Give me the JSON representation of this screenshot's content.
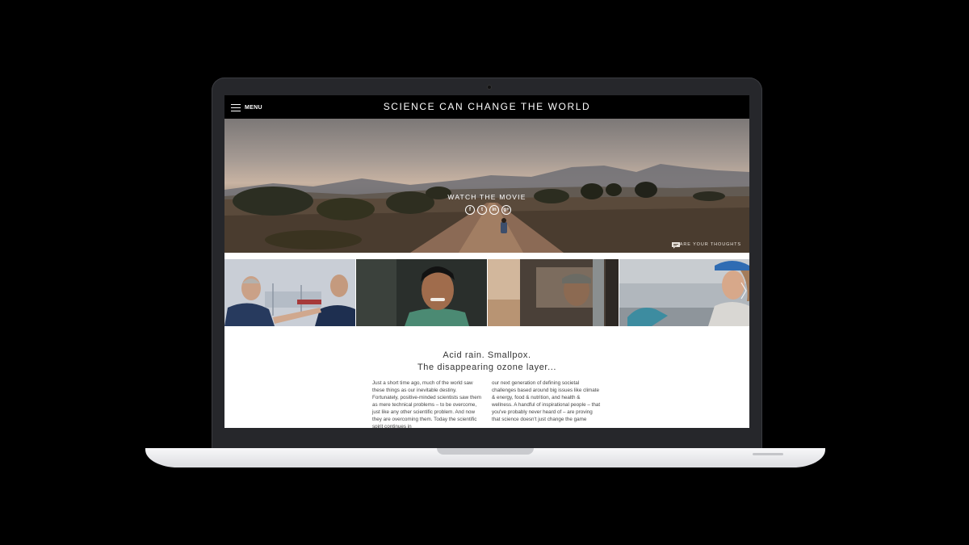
{
  "site": {
    "menu_label": "MENU",
    "title": "SCIENCE CAN CHANGE THE WORLD"
  },
  "hero": {
    "watch_label": "WATCH THE MOVIE",
    "social": [
      {
        "icon": "facebook-icon",
        "glyph": "f"
      },
      {
        "icon": "twitter-icon",
        "glyph": "t"
      },
      {
        "icon": "linkedin-icon",
        "glyph": "in"
      },
      {
        "icon": "google-plus-icon",
        "glyph": "g+"
      }
    ],
    "share_label": "SHARE YOUR THOUGHTS"
  },
  "article": {
    "headline_1": "Acid rain. Smallpox.",
    "headline_2": "The disappearing ozone layer...",
    "col_1": "Just a short time ago, much of the world saw these things as our inevitable destiny. Fortunately, positive-minded scientists saw them as mere technical problems – to be overcome, just like any other scientific problem. And now they are overcoming them. Today the scientific spirit continues in",
    "col_2": "our next generation of defining societal challenges based around big issues like climate & energy, food & nutrition, and health & wellness. A handful of inspirational people – that you've probably never heard of – are proving that science doesn't just change the game"
  },
  "colors": {
    "header_bg": "#000000",
    "laptop_frame": "#26272b",
    "page_bg": "#000000"
  }
}
